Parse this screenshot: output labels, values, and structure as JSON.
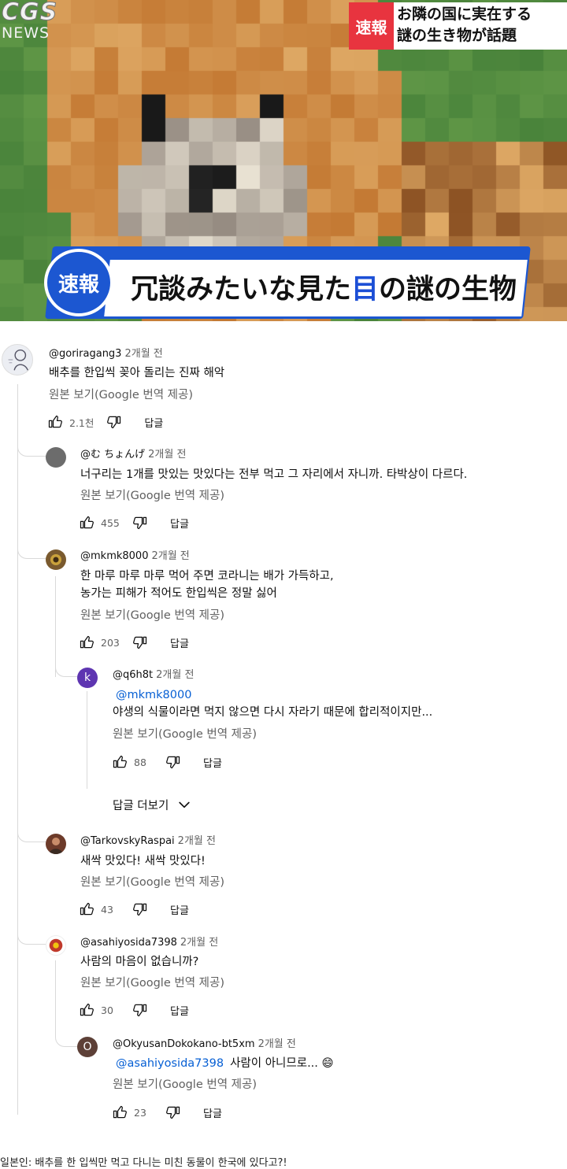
{
  "hero": {
    "logo_top": "CGS",
    "logo_bottom": "NEWS",
    "badge_top": "速報",
    "headline_top": "お隣の国に実在する\n謎の生き物が話題",
    "banner_badge": "速報",
    "banner_text_black": "冗談みたいな見た",
    "banner_text_blue": "目",
    "banner_text_black2": "の謎の生物"
  },
  "comments": [
    {
      "handle": "@goriragang3",
      "time": "2개월 전",
      "lines": [
        "배추를 한입씩 꽂아 돌리는 진짜 해악"
      ],
      "translate": "원본 보기(Google 번역 제공)",
      "likes": "2.1천",
      "reply_label": "답글",
      "avatar_color": "#e9e9ef",
      "avatar_icon": "sketch-avatar-icon"
    },
    {
      "handle": "@む ちょんげ",
      "time": "2개월 전",
      "lines": [
        "너구리는 1개를 맛있는 맛있다는 전부 먹고 그 자리에서 자니까. 타박상이 다르다."
      ],
      "translate": "원본 보기(Google 번역 제공)",
      "likes": "455",
      "reply_label": "답글",
      "avatar_color": "#6c6c6c"
    },
    {
      "handle": "@mkmk8000",
      "time": "2개월 전",
      "lines": [
        "한 마루 마루 마루 먹어 주면 코라니는 배가 가득하고,",
        "농가는 피해가 적어도 한입씩은 정말 싫어"
      ],
      "translate": "원본 보기(Google 번역 제공)",
      "likes": "203",
      "reply_label": "답글",
      "avatar_color": "#7a5a2e"
    },
    {
      "handle": "@q6h8t",
      "time": "2개월 전",
      "mention": "@mkmk8000",
      "lines": [
        "야생의 식물이라면 먹지 않으면 다시 자라기 때문에 합리적이지만..."
      ],
      "translate": "원본 보기(Google 번역 제공)",
      "likes": "88",
      "reply_label": "답글",
      "avatar_color": "#5e35b1",
      "avatar_letter": "k"
    },
    {
      "handle": "@TarkovskyRaspai",
      "time": "2개월 전",
      "lines": [
        "새싹 맛있다! 새싹 맛있다!"
      ],
      "translate": "원본 보기(Google 번역 제공)",
      "likes": "43",
      "reply_label": "답글",
      "avatar_color": "#6d3b2a"
    },
    {
      "handle": "@asahiyosida7398",
      "time": "2개월 전",
      "lines": [
        "사람의 마음이 없습니까?"
      ],
      "translate": "원본 보기(Google 번역 제공)",
      "likes": "30",
      "reply_label": "답글",
      "avatar_color": "#c0392b"
    },
    {
      "handle": "@OkyusanDokokano-bt5xm",
      "time": "2개월 전",
      "mention": "@asahiyosida7398",
      "lines": [
        "사람이 아니므로... 😄"
      ],
      "translate": "원본 보기(Google 번역 제공)",
      "likes": "23",
      "reply_label": "답글",
      "avatar_color": "#5d4037",
      "avatar_letter": "O"
    }
  ],
  "more_replies": "답글 더보기",
  "caption": "일본인: 배추를 한 입씩만 먹고 다니는 미친 동물이 한국에 있다고?!"
}
